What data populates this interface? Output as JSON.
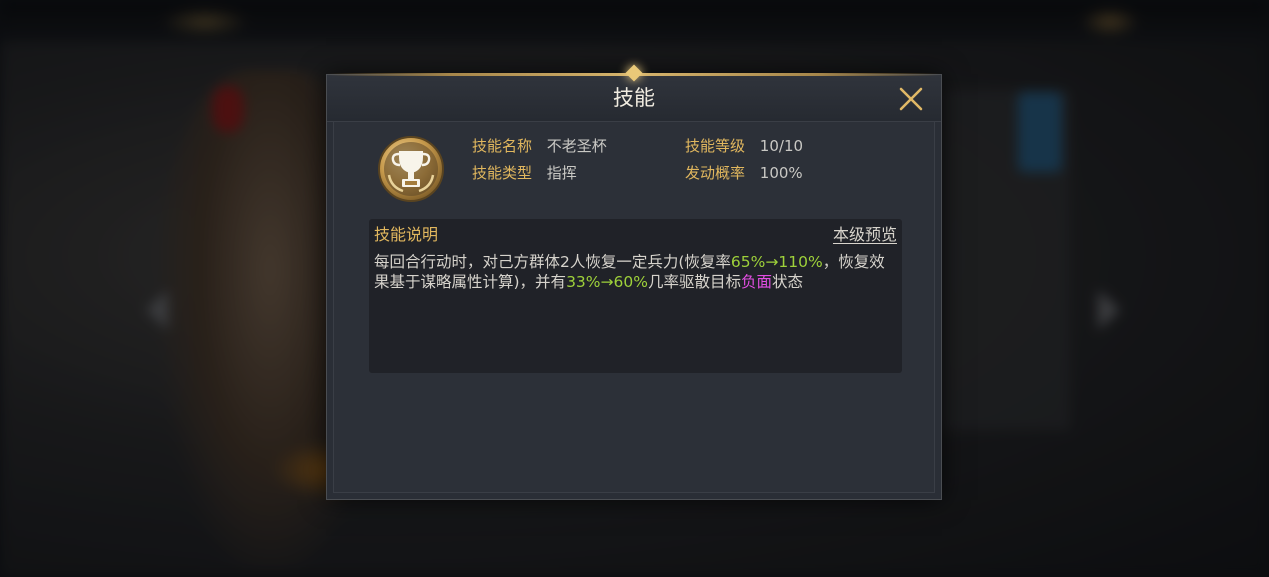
{
  "dialog": {
    "title": "技能",
    "close_icon": "close-x-icon"
  },
  "skill": {
    "icon": "trophy-cup-icon",
    "name_label": "技能名称",
    "name_value": "不老圣杯",
    "type_label": "技能类型",
    "type_value": "指挥",
    "level_label": "技能等级",
    "level_value": "10/10",
    "chance_label": "发动概率",
    "chance_value": "100%"
  },
  "description": {
    "title": "技能说明",
    "preview_link": "本级预览",
    "seg1": "每回合行动时，对己方群体2人恢复一定兵力(恢复率",
    "seg2": "65%→110%",
    "seg3": "，恢复效果基于谋略属性计算)，并有",
    "seg4": "33%→60%",
    "seg5": "几率驱散目标",
    "seg6": "负面",
    "seg7": "状态"
  },
  "colors": {
    "label_gold": "#e1b75e",
    "highlight_green": "#9ed13a",
    "highlight_magenta": "#e24ee2",
    "dialog_bg": "#2a2e36"
  }
}
